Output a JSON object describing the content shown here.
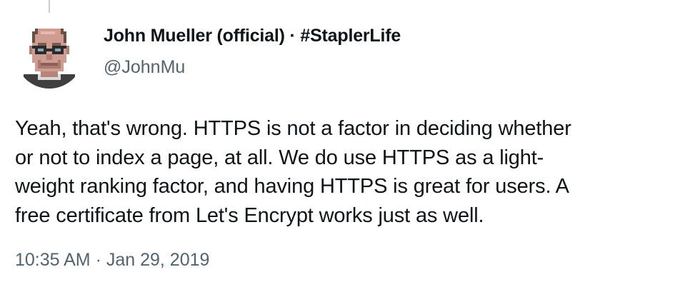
{
  "tweet": {
    "author_name": "John Mueller (official) · #StaplerLife",
    "handle": "@JohnMu",
    "text_lines": [
      "Yeah, that's wrong. HTTPS is not a factor in deciding whether",
      "or not to index a page, at all. We do use HTTPS as a light-",
      "weight ranking factor, and having HTTPS is great for users. A",
      "free certificate from Let's Encrypt works just as well."
    ],
    "timestamp": "10:35 AM · Jan 29, 2019",
    "avatar_icon": "pixel-art-portrait-icon"
  },
  "colors": {
    "text_primary": "#0f1419",
    "text_secondary": "#536471",
    "thread_line": "#c4cfd6"
  }
}
